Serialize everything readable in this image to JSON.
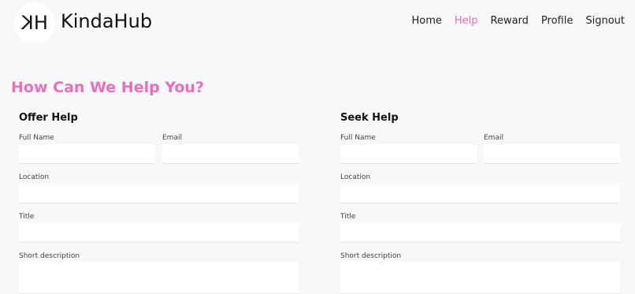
{
  "header": {
    "logo_text": "KH",
    "brand": "KindaHub",
    "nav": [
      {
        "label": "Home",
        "active": false
      },
      {
        "label": "Help",
        "active": true
      },
      {
        "label": "Reward",
        "active": false
      },
      {
        "label": "Profile",
        "active": false
      },
      {
        "label": "Signout",
        "active": false
      }
    ]
  },
  "colors": {
    "accent": "#ea6fb7",
    "background": "#f7f8fa"
  },
  "main": {
    "title": "How Can We Help You?",
    "offer": {
      "title": "Offer Help",
      "full_name_label": "Full Name",
      "email_label": "Email",
      "location_label": "Location",
      "title_label": "Title",
      "description_label": "Short description",
      "full_name_value": "",
      "email_value": "",
      "location_value": "",
      "title_value": "",
      "description_value": ""
    },
    "seek": {
      "title": "Seek Help",
      "full_name_label": "Full Name",
      "email_label": "Email",
      "location_label": "Location",
      "title_label": "Title",
      "description_label": "Short description",
      "full_name_value": "",
      "email_value": "",
      "location_value": "",
      "title_value": "",
      "description_value": ""
    }
  }
}
